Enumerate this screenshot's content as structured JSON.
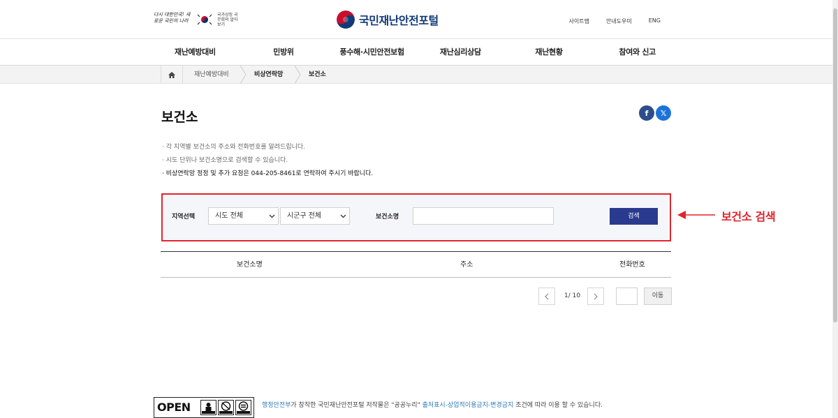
{
  "header": {
    "slogan": "다시 대한민국! 새로운 국민의 나라",
    "gov_text": "국가상징 국무회의 알아보기",
    "brand_name": "국민재난안전포털",
    "utils": [
      "사이트맵",
      "안내도우미",
      "ENG"
    ]
  },
  "nav": {
    "items": [
      "재난예방대비",
      "민방위",
      "풍수해·시민안전보험",
      "재난심리상담",
      "재난현황",
      "참여와 신고"
    ]
  },
  "breadcrumb": {
    "items": [
      "재난예방대비",
      "비상연락망",
      "보건소"
    ]
  },
  "content": {
    "title": "보건소",
    "sns": {
      "facebook": "f",
      "x": "𝕏"
    },
    "notices": [
      "· 각 지역별 보건소의 주소와 전화번호를 알려드립니다.",
      "· 시도 단위나 보건소명으로 검색할 수 있습니다."
    ],
    "notice_strong": "· 비상연락망 정정 및 추가 요청은 044-205-8461로 연락하여 주시기 바랍니다."
  },
  "search": {
    "region_label": "지역선택",
    "sido_value": "시도 전체",
    "sigungu_value": "시군구 전체",
    "name_label": "보건소명",
    "name_value": "",
    "button_label": "검색"
  },
  "annotation": {
    "label": "보건소 검색",
    "color": "#e0242b"
  },
  "table": {
    "headers": [
      "보건소명",
      "주소",
      "전화번호"
    ]
  },
  "pagination": {
    "info": "1/ 10",
    "go_label": "이동",
    "page_input_value": ""
  },
  "footer": {
    "open_label": "OPEN",
    "agency": "행정안전부",
    "text_mid": "가 창작한 국민재난안전포털 저작물은 \"공공누리\" ",
    "license_link": "출처표시-상업적이용금지-변경금지",
    "text_end": " 조건에 따라 이용 할 수 있습니다."
  }
}
